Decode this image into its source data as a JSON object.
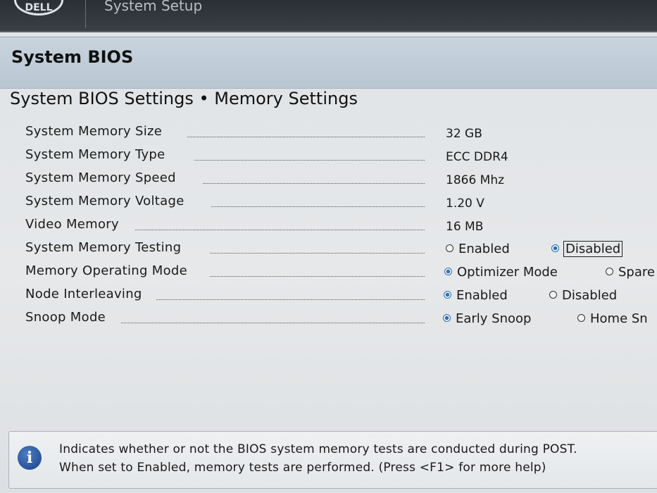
{
  "topbar": {
    "logo": "DELL",
    "app_title": "System Setup"
  },
  "header": {
    "title": "System BIOS"
  },
  "section": {
    "title": "System BIOS Settings • Memory Settings"
  },
  "settings": [
    {
      "label": "System Memory Size",
      "value": "32 GB"
    },
    {
      "label": "System Memory Type",
      "value": "ECC DDR4"
    },
    {
      "label": "System Memory Speed",
      "value": "1866 Mhz"
    },
    {
      "label": "System Memory Voltage",
      "value": "1.20 V"
    },
    {
      "label": "Video Memory",
      "value": "16 MB"
    },
    {
      "label": "System Memory Testing",
      "options": [
        {
          "label": "Enabled",
          "selected": false
        },
        {
          "label": "Disabled",
          "selected": true
        }
      ]
    },
    {
      "label": "Memory Operating Mode",
      "options": [
        {
          "label": "Optimizer Mode",
          "selected": true
        },
        {
          "label": "Spare",
          "selected": false
        }
      ]
    },
    {
      "label": "Node Interleaving",
      "options": [
        {
          "label": "Enabled",
          "selected": true
        },
        {
          "label": "Disabled",
          "selected": false
        }
      ]
    },
    {
      "label": "Snoop Mode",
      "options": [
        {
          "label": "Early Snoop",
          "selected": true
        },
        {
          "label": "Home Sn",
          "selected": false
        }
      ]
    }
  ],
  "help": {
    "icon": "info-icon",
    "line1": "Indicates whether or not the BIOS system memory tests are conducted during POST.",
    "line2": "When set to Enabled, memory tests are performed. (Press <F1> for more help)"
  },
  "colors": {
    "topbar": "#2b2f35",
    "header_band": "#c3cfda",
    "radio_selected": "#2a6fb0",
    "info_icon": "#17408a"
  }
}
